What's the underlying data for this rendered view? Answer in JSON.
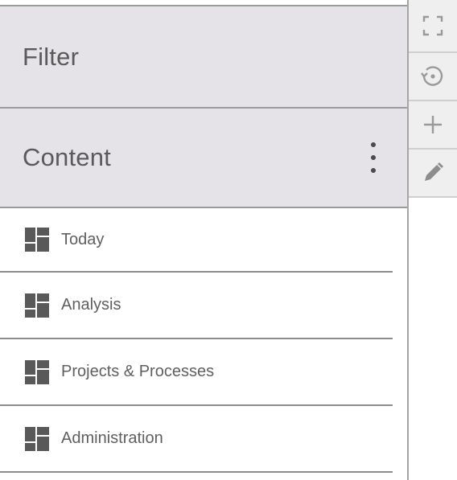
{
  "panel": {
    "filter_label": "Filter",
    "content_label": "Content",
    "items": [
      {
        "label": "Today",
        "icon": "dashboard-icon"
      },
      {
        "label": "Analysis",
        "icon": "dashboard-icon"
      },
      {
        "label": "Projects & Processes",
        "icon": "dashboard-icon"
      },
      {
        "label": "Administration",
        "icon": "dashboard-icon"
      }
    ]
  },
  "toolbar": {
    "tools": [
      "fullscreen-icon",
      "history-icon",
      "add-icon",
      "edit-icon"
    ]
  },
  "colors": {
    "header_bg": "#e6e3e8",
    "divider": "#9b9a9d",
    "text": "#5f5f5f",
    "icon": "#595959",
    "tool_bg": "#efefef"
  }
}
